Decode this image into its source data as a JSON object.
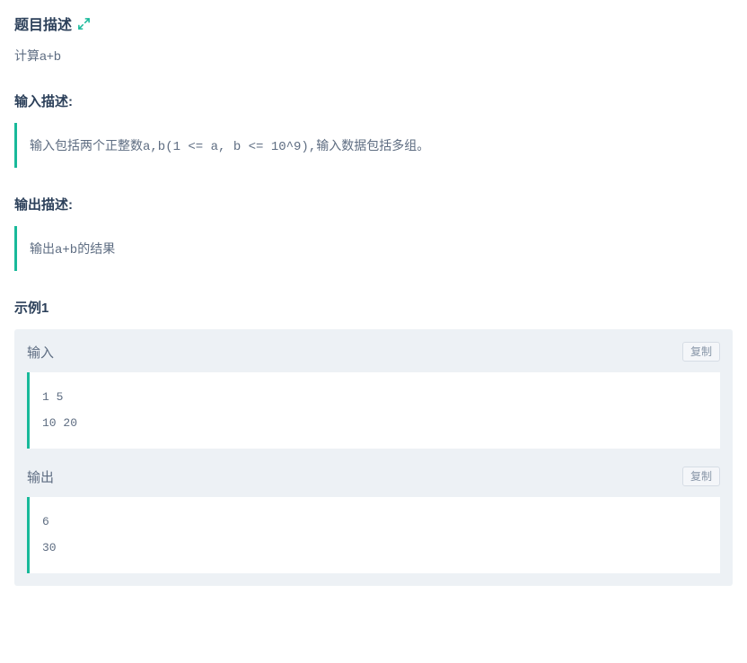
{
  "problem": {
    "title": "题目描述",
    "description": "计算a+b"
  },
  "input": {
    "title": "输入描述:",
    "description": "输入包括两个正整数a,b(1 <= a, b <= 10^9),输入数据包括多组。"
  },
  "output": {
    "title": "输出描述:",
    "description": "输出a+b的结果"
  },
  "example": {
    "title": "示例1",
    "input_label": "输入",
    "output_label": "输出",
    "copy_label": "复制",
    "input_data": "1 5\n10 20",
    "output_data": "6\n30"
  }
}
